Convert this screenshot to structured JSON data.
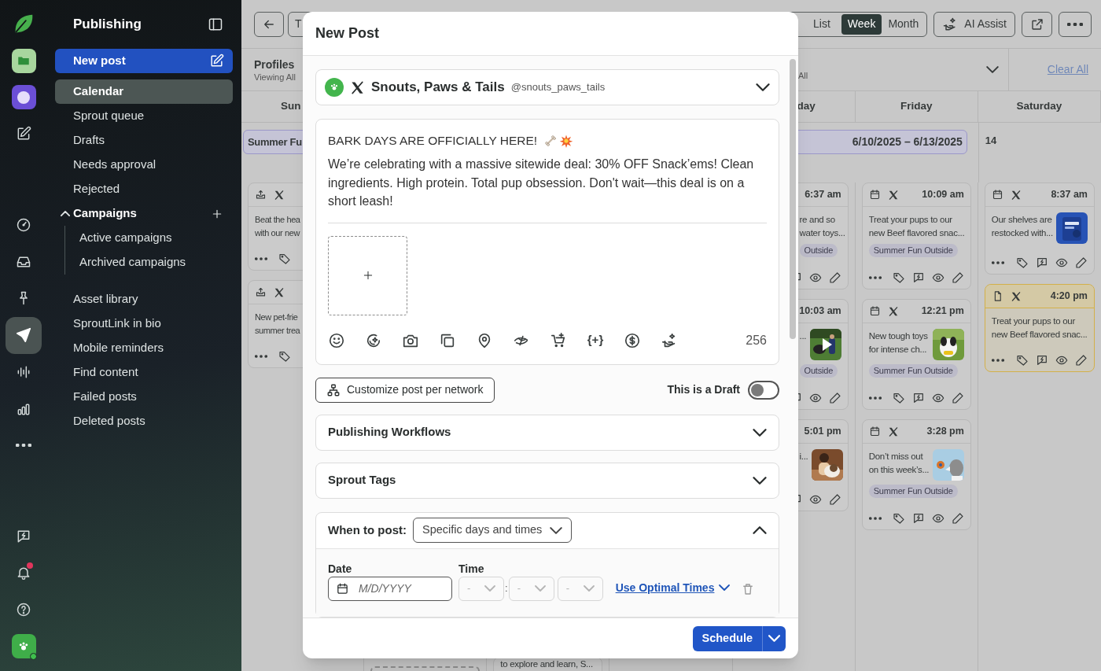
{
  "rail": {
    "top": [
      {
        "kind": "logo",
        "selected": false
      },
      {
        "kind": "workspace",
        "selected": false
      },
      {
        "kind": "app",
        "selected": false
      },
      {
        "kind": "compose",
        "selected": false
      }
    ],
    "main": [
      {
        "kind": "gauge",
        "selected": false
      },
      {
        "kind": "inbox",
        "selected": false
      },
      {
        "kind": "pin",
        "selected": false
      },
      {
        "kind": "send",
        "selected": true
      },
      {
        "kind": "wave",
        "selected": false
      },
      {
        "kind": "bars",
        "selected": false
      },
      {
        "kind": "more",
        "selected": false
      }
    ],
    "bottom": [
      {
        "kind": "bolt-chat",
        "selected": false
      },
      {
        "kind": "bell",
        "selected": false,
        "unread": true
      },
      {
        "kind": "help",
        "selected": false
      },
      {
        "kind": "avatar",
        "selected": false,
        "online": true
      }
    ]
  },
  "sidebar": {
    "title": "Publishing",
    "new_post": "New post",
    "items": [
      {
        "label": "Calendar",
        "selected": true
      },
      {
        "label": "Sprout queue",
        "selected": false
      },
      {
        "label": "Drafts",
        "selected": false
      },
      {
        "label": "Needs approval",
        "selected": false
      },
      {
        "label": "Rejected",
        "selected": false
      },
      {
        "label": "Campaigns",
        "selected": false,
        "expanded": true,
        "children": [
          {
            "label": "Active campaigns",
            "selected": false
          },
          {
            "label": "Archived campaigns",
            "selected": false
          }
        ]
      },
      {
        "label": "Asset library",
        "selected": false
      },
      {
        "label": "SproutLink in bio",
        "selected": false
      },
      {
        "label": "Mobile reminders",
        "selected": false
      },
      {
        "label": "Find content",
        "selected": false
      },
      {
        "label": "Failed posts",
        "selected": false
      },
      {
        "label": "Deleted posts",
        "selected": false
      }
    ]
  },
  "calendar": {
    "partial_button": "T",
    "views": [
      {
        "label": "List",
        "selected": false
      },
      {
        "label": "Week",
        "selected": true
      },
      {
        "label": "Month",
        "selected": false
      }
    ],
    "ai_button": "AI Assist",
    "profiles": {
      "label": "Profiles",
      "value": "Viewing All"
    },
    "filter_value": "All",
    "clear": "Clear All",
    "campaign_banner": {
      "label": "Summer Fu",
      "dates": "6/10/2025 – 6/13/2025"
    },
    "columns": [
      {
        "header": "Sun",
        "cards": [
          {
            "kind": "sent",
            "text_lines": [
              "Beat the hea",
              "with our new"
            ]
          },
          {
            "kind": "sent",
            "text_lines": [
              "New pet-frie",
              "summer trea"
            ]
          }
        ]
      },
      {
        "cards": [
          {
            "kind": "placeholder"
          }
        ]
      },
      {
        "cards": [
          {
            "kind": "post",
            "text_lines": [
              "to explore and learn, S..."
            ]
          }
        ]
      },
      {},
      {
        "header": "day",
        "cards": [
          {
            "kind": "post",
            "time": "6:37 am",
            "text_lines": [
              "re and so",
              "water toys..."
            ],
            "tag": "Outside"
          },
          {
            "kind": "post",
            "time": "10:03 am",
            "text_lines": [
              "..."
            ],
            "media": true,
            "playable": true,
            "tag": "Outside"
          },
          {
            "kind": "post",
            "time": "5:01 pm",
            "text_lines": [
              "i..."
            ],
            "media": true,
            "playable": false
          }
        ]
      },
      {
        "header": "Friday",
        "cards": [
          {
            "kind": "scheduled",
            "time": "10:09 am",
            "text_lines": [
              "Treat your pups to our",
              "new Beef flavored snac..."
            ],
            "tag": "Summer Fun Outside"
          },
          {
            "kind": "scheduled",
            "time": "12:21 pm",
            "text_lines": [
              "New tough toys",
              "for intense ch..."
            ],
            "media": true,
            "playable": false,
            "tag": "Summer Fun Outside"
          },
          {
            "kind": "scheduled",
            "time": "3:28 pm",
            "text_lines": [
              "Don’t miss out",
              "on this week’s..."
            ],
            "media": true,
            "playable": false,
            "tag": "Summer Fun Outside"
          }
        ]
      },
      {
        "header": "Saturday",
        "date": "14",
        "cards": [
          {
            "kind": "scheduled",
            "time": "8:37 am",
            "text_lines": [
              "Our shelves are",
              "restocked with..."
            ],
            "media": true,
            "playable": false
          },
          {
            "kind": "draft",
            "time": "4:20 pm",
            "text_lines": [
              "Treat your pups to our",
              "new Beef flavored snac..."
            ]
          }
        ]
      }
    ]
  },
  "modal": {
    "title": "New Post",
    "profile": {
      "name": "Snouts, Paws & Tails",
      "handle": "@snouts_paws_tails"
    },
    "composer": {
      "headline": "BARK DAYS ARE OFFICIALLY HERE!",
      "body": "We’re celebrating with a massive sitewide deal: 30% OFF Snack’ems! Clean ingredients. High protein. Total pup obsession. Don't wait—this deal is on a short leash!",
      "variables": "{+}",
      "char_count": "256"
    },
    "customize_button": "Customize post per network",
    "draft_toggle": {
      "label": "This is a Draft",
      "on": false
    },
    "sections": [
      {
        "title": "Publishing Workflows",
        "expanded": false
      },
      {
        "title": "Sprout Tags",
        "expanded": false
      }
    ],
    "when": {
      "label": "When to post:",
      "mode": "Specific days and times",
      "expanded": true,
      "date_label": "Date",
      "date_placeholder": "M/D/YYYY",
      "time_label": "Time",
      "time_fields": [
        {
          "placeholder": "-",
          "disabled": true
        },
        {
          "placeholder": "-",
          "disabled": true
        },
        {
          "placeholder": "-",
          "disabled": true
        }
      ],
      "separator": ":",
      "optimal_link": "Use Optimal Times"
    },
    "schedule_button": "Schedule"
  }
}
